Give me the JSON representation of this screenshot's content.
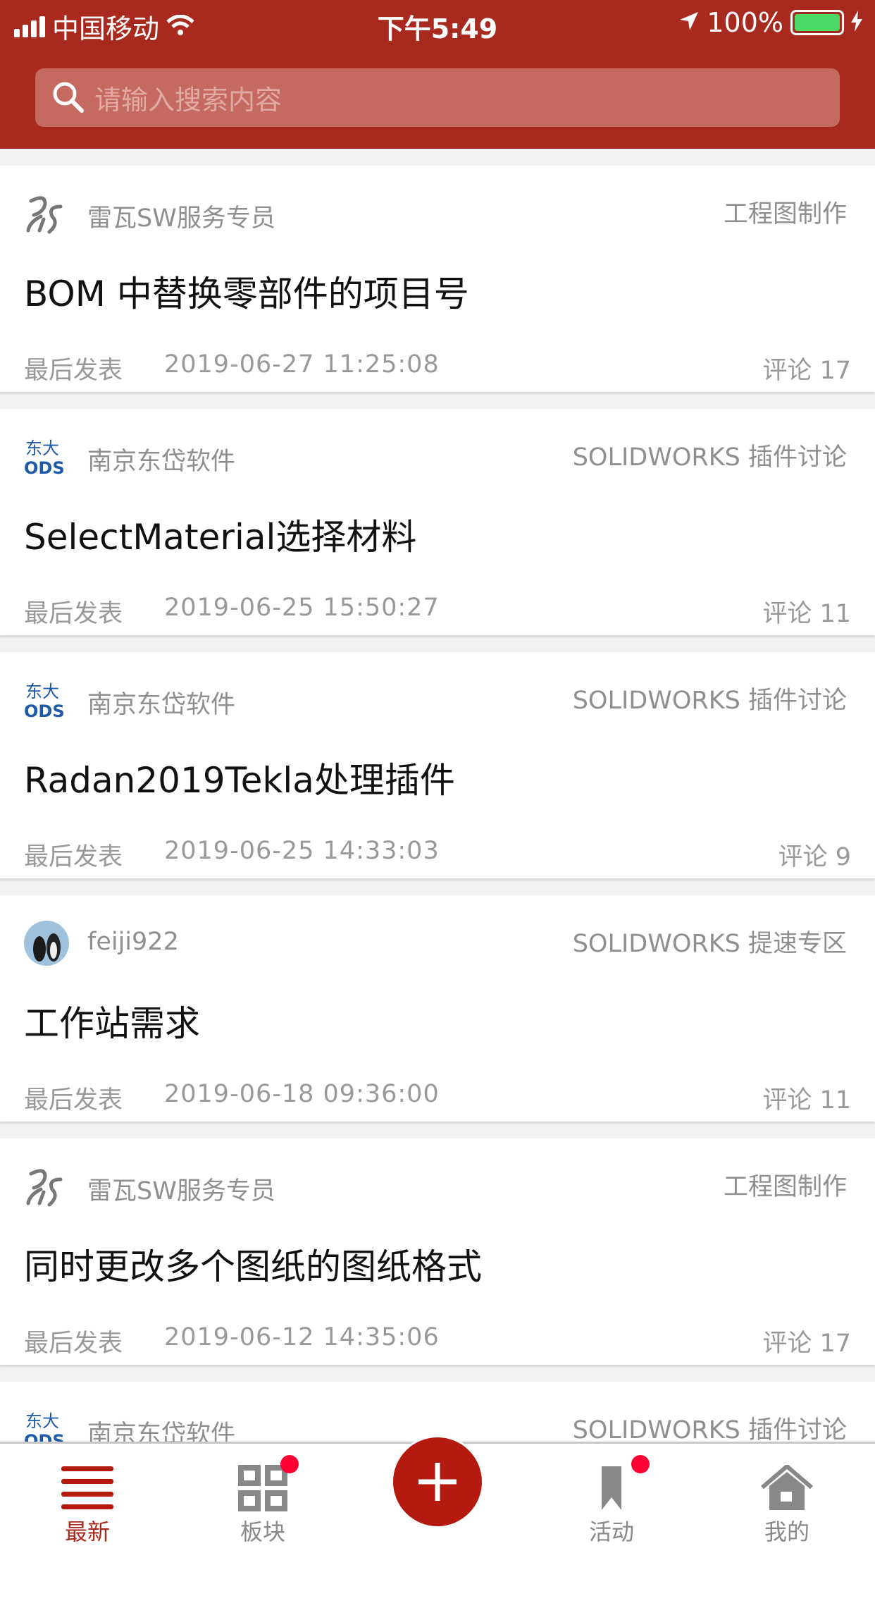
{
  "status_bar": {
    "carrier": "中国移动",
    "time": "下午5:49",
    "battery": "100%"
  },
  "search": {
    "placeholder": "请输入搜索内容"
  },
  "posts": [
    {
      "author": "雷瓦SW服务专员",
      "avatar": "3ds-logo",
      "forum": "工程图制作",
      "title": "BOM 中替换零部件的项目号",
      "footer_label": "最后发表",
      "date": "2019-06-27 11:25:08",
      "comments": "评论 17"
    },
    {
      "author": "南京东岱软件",
      "avatar": "dongda-logo",
      "forum": "SOLIDWORKS 插件讨论",
      "title": "SelectMaterial选择材料",
      "footer_label": "最后发表",
      "date": "2019-06-25 15:50:27",
      "comments": "评论 11"
    },
    {
      "author": "南京东岱软件",
      "avatar": "dongda-logo",
      "forum": "SOLIDWORKS 插件讨论",
      "title": "Radan2019Tekla处理插件",
      "footer_label": "最后发表",
      "date": "2019-06-25 14:33:03",
      "comments": "评论 9"
    },
    {
      "author": "feiji922",
      "avatar": "penguin-photo",
      "forum": "SOLIDWORKS 提速专区",
      "title": "工作站需求",
      "footer_label": "最后发表",
      "date": "2019-06-18 09:36:00",
      "comments": "评论 11"
    },
    {
      "author": "雷瓦SW服务专员",
      "avatar": "3ds-logo",
      "forum": "工程图制作",
      "title": "同时更改多个图纸的图纸格式",
      "footer_label": "最后发表",
      "date": "2019-06-12 14:35:06",
      "comments": "评论 17"
    },
    {
      "author": "南京东岱软件",
      "avatar": "dongda-logo",
      "forum": "SOLIDWORKS 插件讨论"
    }
  ],
  "nav": {
    "tabs": [
      {
        "label": "最新",
        "active": true
      },
      {
        "label": "板块",
        "badge": true
      },
      {
        "label": "活动",
        "badge": true
      },
      {
        "label": "我的"
      }
    ]
  },
  "colors": {
    "brand": "#a8291e",
    "fab": "#b51a0e",
    "badge": "#ff0033"
  }
}
